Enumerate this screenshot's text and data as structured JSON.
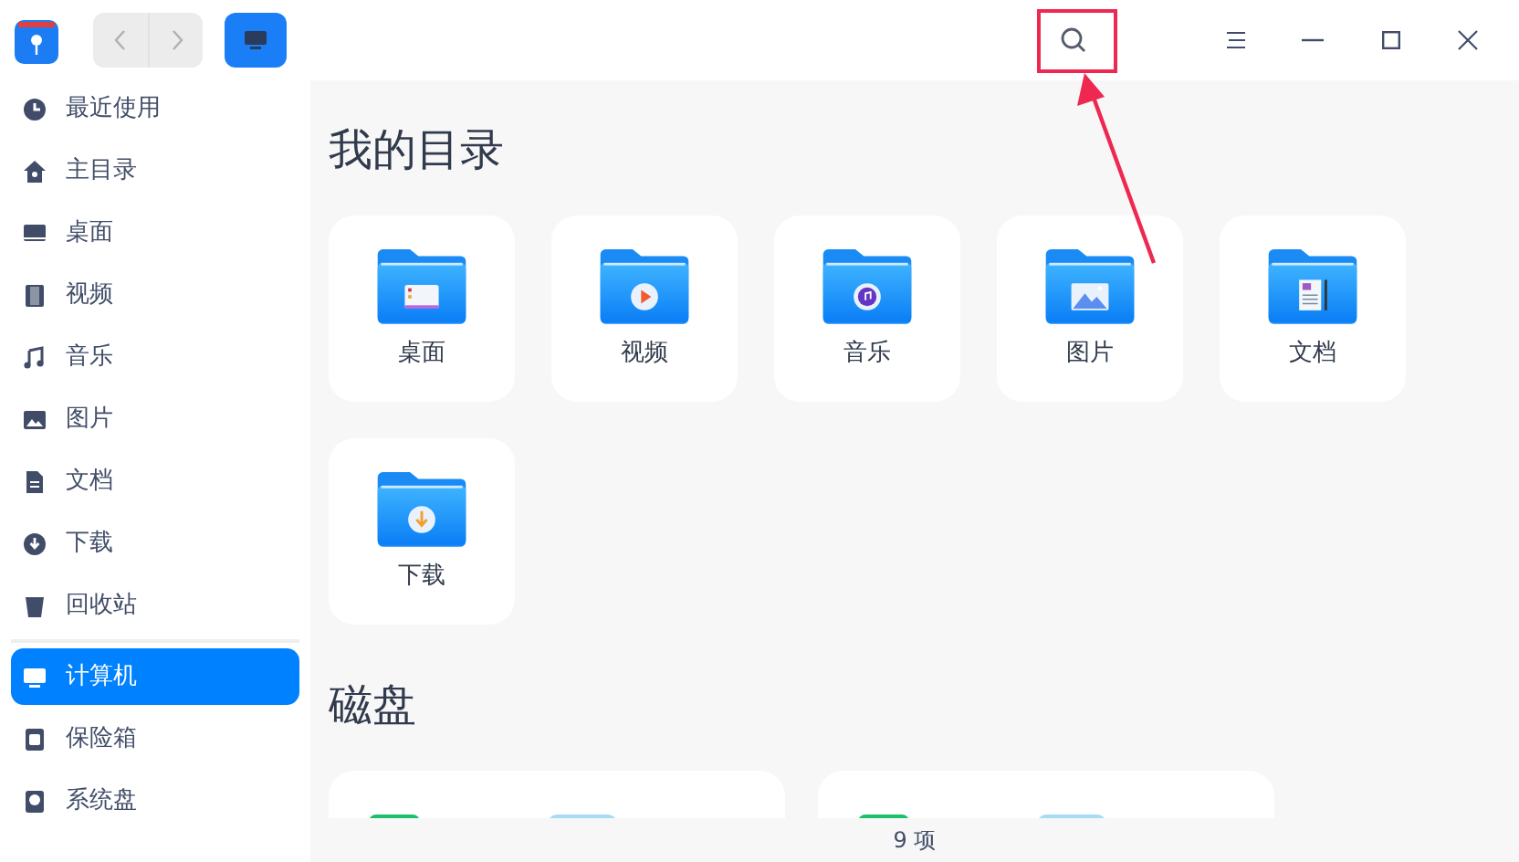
{
  "sidebar": {
    "groups": [
      {
        "items": [
          {
            "label": "最近使用",
            "kind": "clock",
            "selected": false
          },
          {
            "label": "主目录",
            "kind": "home",
            "selected": false
          },
          {
            "label": "桌面",
            "kind": "desktop",
            "selected": false
          },
          {
            "label": "视频",
            "kind": "film",
            "selected": false
          },
          {
            "label": "音乐",
            "kind": "music",
            "selected": false
          },
          {
            "label": "图片",
            "kind": "image",
            "selected": false
          },
          {
            "label": "文档",
            "kind": "doc",
            "selected": false
          },
          {
            "label": "下载",
            "kind": "download",
            "selected": false
          },
          {
            "label": "回收站",
            "kind": "trash",
            "selected": false
          }
        ]
      },
      {
        "items": [
          {
            "label": "计算机",
            "kind": "computer",
            "selected": true
          },
          {
            "label": "保险箱",
            "kind": "safe",
            "selected": false
          },
          {
            "label": "系统盘",
            "kind": "disk",
            "selected": false
          }
        ]
      }
    ]
  },
  "sections": [
    {
      "title": "我的目录",
      "kind": "folders",
      "items": [
        {
          "label": "桌面",
          "kind": "desktop"
        },
        {
          "label": "视频",
          "kind": "video"
        },
        {
          "label": "音乐",
          "kind": "music"
        },
        {
          "label": "图片",
          "kind": "image"
        },
        {
          "label": "文档",
          "kind": "doc"
        },
        {
          "label": "下载",
          "kind": "download"
        }
      ]
    },
    {
      "title": "磁盘",
      "kind": "disks",
      "items": [
        {
          "kind": "disk"
        },
        {
          "kind": "disk"
        }
      ]
    }
  ],
  "status_bar": {
    "text": "9 项"
  }
}
